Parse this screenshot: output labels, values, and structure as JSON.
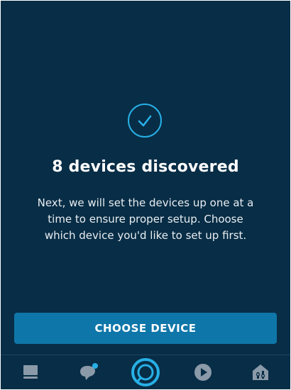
{
  "discovery": {
    "title": "8 devices discovered",
    "message": "Next, we will set the devices up one at a time to ensure proper setup. Choose which device you'd like to set up first."
  },
  "actions": {
    "choose_device_label": "CHOOSE DEVICE"
  },
  "nav": {
    "items": [
      {
        "icon": "home-icon"
      },
      {
        "icon": "communicate-icon"
      },
      {
        "icon": "alexa-icon"
      },
      {
        "icon": "play-icon"
      },
      {
        "icon": "devices-icon"
      }
    ]
  },
  "colors": {
    "background": "#082d46",
    "accent": "#27b0e6",
    "button": "#0f76a9",
    "nav_icon": "#8a9aa8"
  }
}
